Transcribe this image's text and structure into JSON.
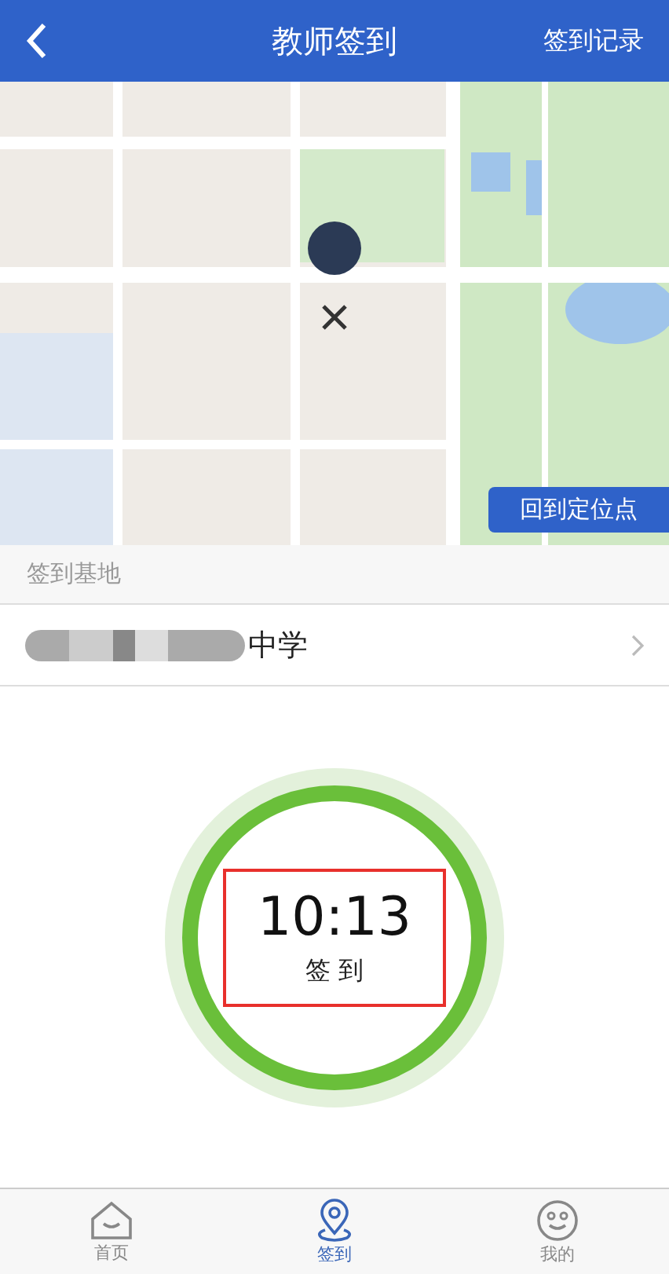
{
  "header": {
    "title": "教师签到",
    "action": "签到记录"
  },
  "map": {
    "button": "回到定位点"
  },
  "base": {
    "label": "签到基地",
    "value": "中学"
  },
  "checkin": {
    "time": "10:13",
    "label": "签 到"
  },
  "tabs": [
    {
      "label": "首页",
      "kind": "home",
      "selected": false
    },
    {
      "label": "签到",
      "kind": "pin",
      "selected": true
    },
    {
      "label": "我的",
      "kind": "smile",
      "selected": false
    }
  ]
}
